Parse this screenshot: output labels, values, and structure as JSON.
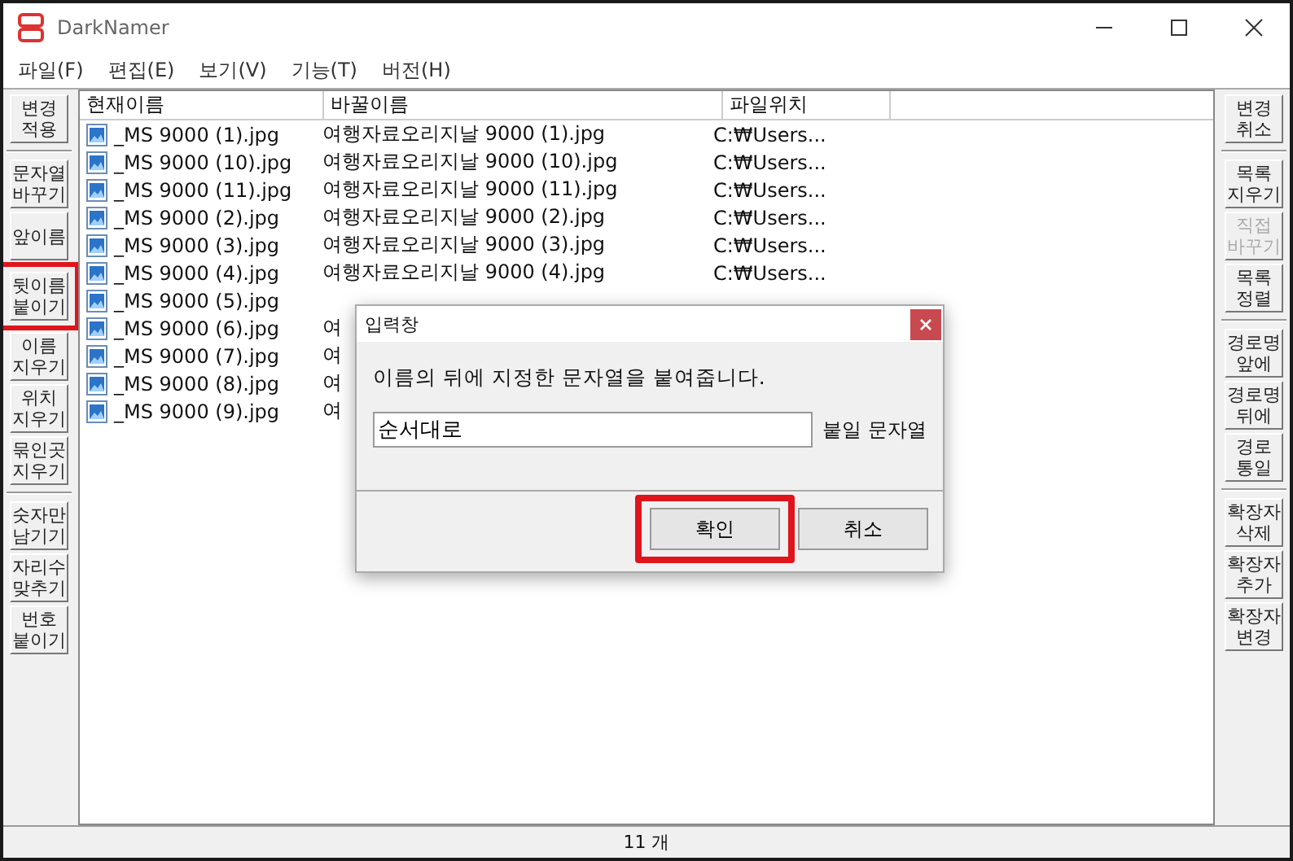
{
  "window": {
    "title": "DarkNamer"
  },
  "menu": [
    "파일(F)",
    "편집(E)",
    "보기(V)",
    "기능(T)",
    "버전(H)"
  ],
  "left_groups": [
    [
      {
        "lines": [
          "변경",
          "적용"
        ],
        "highlighted": false
      }
    ],
    [
      {
        "lines": [
          "문자열",
          "바꾸기"
        ],
        "highlighted": false
      },
      {
        "lines": [
          "앞이름"
        ],
        "highlighted": false
      },
      {
        "lines": [
          "뒷이름",
          "붙이기"
        ],
        "highlighted": true
      },
      {
        "lines": [
          "이름",
          "지우기"
        ],
        "highlighted": false
      },
      {
        "lines": [
          "위치",
          "지우기"
        ],
        "highlighted": false
      },
      {
        "lines": [
          "묶인곳",
          "지우기"
        ],
        "highlighted": false
      }
    ],
    [
      {
        "lines": [
          "숫자만",
          "남기기"
        ],
        "highlighted": false
      },
      {
        "lines": [
          "자리수",
          "맞추기"
        ],
        "highlighted": false
      },
      {
        "lines": [
          "번호",
          "붙이기"
        ],
        "highlighted": false
      }
    ]
  ],
  "table": {
    "columns": [
      "현재이름",
      "바꿀이름",
      "파일위치"
    ],
    "rows": [
      {
        "current": "_MS 9000 (1).jpg",
        "new_name": "여행자료오리지날 9000 (1).jpg",
        "location": "C:₩Users..."
      },
      {
        "current": "_MS 9000 (10).jpg",
        "new_name": "여행자료오리지날 9000 (10).jpg",
        "location": "C:₩Users..."
      },
      {
        "current": "_MS 9000 (11).jpg",
        "new_name": "여행자료오리지날 9000 (11).jpg",
        "location": "C:₩Users..."
      },
      {
        "current": "_MS 9000 (2).jpg",
        "new_name": "여행자료오리지날 9000 (2).jpg",
        "location": "C:₩Users..."
      },
      {
        "current": "_MS 9000 (3).jpg",
        "new_name": "여행자료오리지날 9000 (3).jpg",
        "location": "C:₩Users..."
      },
      {
        "current": "_MS 9000 (4).jpg",
        "new_name": "여행자료오리지날 9000 (4).jpg",
        "location": "C:₩Users..."
      },
      {
        "current": "_MS 9000 (5).jpg"
      },
      {
        "current": "_MS 9000 (6).jpg",
        "new_name": "여"
      },
      {
        "current": "_MS 9000 (7).jpg",
        "new_name": "여"
      },
      {
        "current": "_MS 9000 (8).jpg",
        "new_name": "여"
      },
      {
        "current": "_MS 9000 (9).jpg",
        "new_name": "여"
      }
    ]
  },
  "right_groups": [
    [
      {
        "lines": [
          "변경",
          "취소"
        ],
        "disabled": false
      }
    ],
    [
      {
        "lines": [
          "목록",
          "지우기"
        ],
        "disabled": false
      },
      {
        "lines": [
          "직접",
          "바꾸기"
        ],
        "disabled": true
      },
      {
        "lines": [
          "목록",
          "정렬"
        ],
        "disabled": false
      }
    ],
    [
      {
        "lines": [
          "경로명",
          "앞에"
        ],
        "disabled": false
      },
      {
        "lines": [
          "경로명",
          "뒤에"
        ],
        "disabled": false
      },
      {
        "lines": [
          "경로",
          "통일"
        ],
        "disabled": false
      }
    ],
    [
      {
        "lines": [
          "확장자",
          "삭제"
        ],
        "disabled": false
      },
      {
        "lines": [
          "확장자",
          "추가"
        ],
        "disabled": false
      },
      {
        "lines": [
          "확장자",
          "변경"
        ],
        "disabled": false
      }
    ]
  ],
  "status_bar": "11 개",
  "dialog": {
    "title": "입력창",
    "message": "이름의 뒤에 지정한 문자열을 붙여줍니다.",
    "value": "순서대로",
    "field_label": "붙일 문자열",
    "buttons": [
      {
        "label": "확인",
        "highlighted": true
      },
      {
        "label": "취소",
        "highlighted": false
      }
    ]
  }
}
